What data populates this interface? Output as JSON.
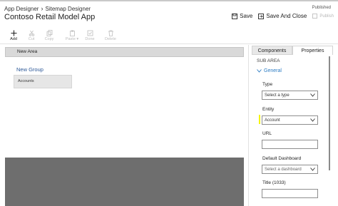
{
  "header": {
    "breadcrumb": [
      "App Designer",
      "Sitemap Designer"
    ],
    "title": "Contoso Retail Model App",
    "status": "Published",
    "actions": {
      "save": "Save",
      "save_and_close": "Save And Close",
      "publish": "Publish"
    }
  },
  "toolbar": {
    "add": "Add",
    "cut": "Cut",
    "copy": "Copy",
    "paste": "Paste",
    "done": "Done",
    "delete": "Delete"
  },
  "canvas": {
    "area_label": "New Area",
    "group_label": "New Group",
    "subarea_label": "Accounts"
  },
  "panel": {
    "tabs": [
      "Components",
      "Properties"
    ],
    "active_tab": "Properties",
    "section": "SUB AREA",
    "group": "General",
    "type": {
      "label": "Type",
      "value": "Select a type"
    },
    "entity": {
      "label": "Entity",
      "value": "Account"
    },
    "url": {
      "label": "URL",
      "value": ""
    },
    "default_dashboard": {
      "label": "Default Dashboard",
      "value": "Select a dashboard"
    },
    "title": {
      "label": "Title (1033)",
      "value": ""
    }
  },
  "colors": {
    "accent_blue": "#2b7bc3",
    "group_blue": "#2b5797",
    "highlight": "#f5f500",
    "dark_region": "#6e6e6e"
  }
}
